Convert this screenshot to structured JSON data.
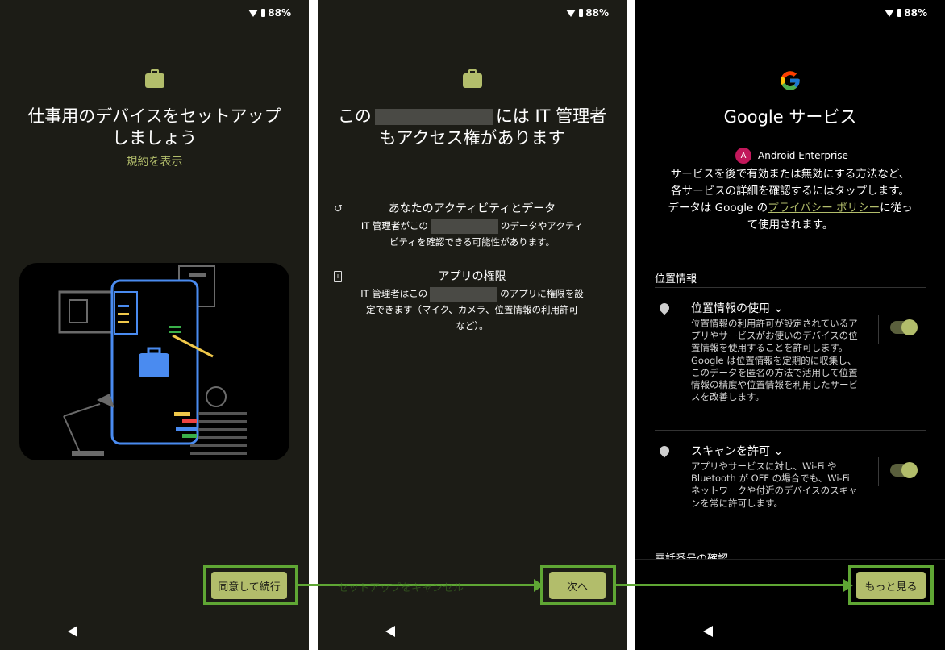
{
  "status": {
    "battery": "88%"
  },
  "screen1": {
    "title_line1": "仕事用のデバイスをセットアップ",
    "title_line2": "しましょう",
    "terms_link": "規約を表示",
    "agree_button": "同意して続行"
  },
  "screen2": {
    "title_pre": "この",
    "title_post": "には IT 管理者",
    "title_line2": "もアクセス権があります",
    "item1": {
      "heading": "あなたのアクティビティとデータ",
      "body_pre": "IT 管理者がこの",
      "body_mid": "のデータやアクティ",
      "body_line2": "ビティを確認できる可能性があります。"
    },
    "item2": {
      "heading": "アプリの権限",
      "body_pre": "IT 管理者はこの",
      "body_mid": "のアプリに権限を設",
      "body_line2": "定できます（マイク、カメラ、位置情報の利用許可",
      "body_line3": "など）。"
    },
    "cancel_link": "セットアップをキャンセル",
    "next_button": "次へ"
  },
  "screen3": {
    "title": "Google サービス",
    "account_initial": "A",
    "account_name": "Android Enterprise",
    "desc_line1": "サービスを後で有効または無効にする方法など、",
    "desc_line2": "各サービスの詳細を確認するにはタップします。",
    "desc_line3_pre": "データは Google の",
    "desc_link": "プライバシー ポリシー",
    "desc_line3_post": "に従っ",
    "desc_line4": "て使用されます。",
    "section_location": "位置情報",
    "perm1": {
      "title": "位置情報の使用",
      "body": "位置情報の利用許可が設定されているアプリやサービスがお使いのデバイスの位置情報を使用することを許可します。Google は位置情報を定期的に収集し、このデータを匿名の方法で活用して位置情報の精度や位置情報を利用したサービスを改善します。"
    },
    "perm2": {
      "title": "スキャンを許可",
      "body": "アプリやサービスに対し、Wi-Fi や Bluetooth が OFF の場合でも、Wi-Fi ネットワークや付近のデバイスのスキャンを常に許可します。"
    },
    "section_phone": "電話番号の確認",
    "more_button": "もっと見る"
  },
  "colors": {
    "accent": "#b2bd6b",
    "highlight": "#5fa634",
    "bg_dark": "#1c1c16"
  }
}
